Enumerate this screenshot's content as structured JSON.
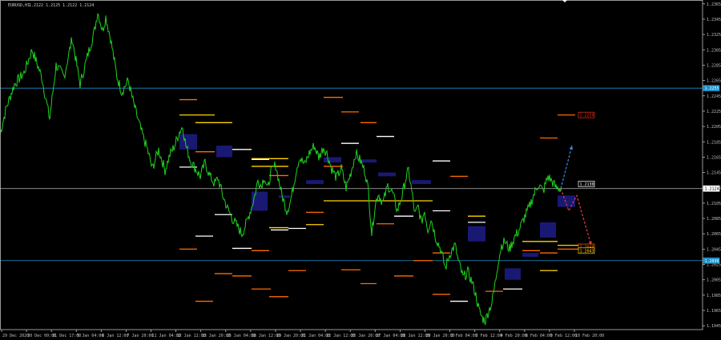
{
  "header": {
    "symbol": "EURUSD,H1",
    "ohlc": "1.2122 1.2125 1.2122 1.2124"
  },
  "colors": {
    "background": "#000000",
    "price_line": "#1fd21f",
    "axis": "#bfbfbf",
    "level_line": "#1e90c8",
    "current_line": "#9a9a9a",
    "zone": "#1a1a7a",
    "seg_white": "#ffffff",
    "seg_yellow": "#ffd400",
    "seg_orange": "#ff6a00",
    "seg_red": "#e03018",
    "arrow_blue": "#3b8fe6",
    "arrow_red": "#e83a3a"
  },
  "chart_data": {
    "type": "line",
    "title": "EURUSD,H1",
    "y_ticks": [
      "1.2365",
      "1.2345",
      "1.2325",
      "1.2305",
      "1.2285",
      "1.2265",
      "1.2245",
      "1.2225",
      "1.2205",
      "1.2185",
      "1.2165",
      "1.2145",
      "1.2125",
      "1.2105",
      "1.2085",
      "1.2065",
      "1.2045",
      "1.2025",
      "1.2005",
      "1.1985",
      "1.1965",
      "1.1945"
    ],
    "x_ticks": [
      "29 Dec 2020",
      "30 Dec 09:00",
      "31 Dec 17:00",
      "5 Jan 04:00",
      "6 Jan 12:00",
      "7 Jan 20:00",
      "11 Jan 04:00",
      "12 Jan 12:00",
      "13 Jan 20:00",
      "15 Jan 04:00",
      "18 Jan 12:00",
      "19 Jan 20:00",
      "21 Jan 04:00",
      "22 Jan 12:00",
      "25 Jan 20:00",
      "27 Jan 04:00",
      "28 Jan 12:00",
      "29 Jan 20:00",
      "2 Feb 04:00",
      "3 Feb 12:00",
      "4 Feb 20:00",
      "8 Feb 04:00",
      "9 Feb 12:00",
      "10 Feb 20:00"
    ],
    "ylim": [
      1.194,
      1.237
    ],
    "price_path": [
      [
        0,
        1.2195
      ],
      [
        8,
        1.223
      ],
      [
        18,
        1.226
      ],
      [
        30,
        1.2275
      ],
      [
        40,
        1.2305
      ],
      [
        52,
        1.227
      ],
      [
        62,
        1.2215
      ],
      [
        70,
        1.2285
      ],
      [
        80,
        1.227
      ],
      [
        90,
        1.232
      ],
      [
        100,
        1.226
      ],
      [
        110,
        1.23
      ],
      [
        118,
        1.233
      ],
      [
        122,
        1.2355
      ],
      [
        128,
        1.233
      ],
      [
        132,
        1.2348
      ],
      [
        138,
        1.232
      ],
      [
        146,
        1.227
      ],
      [
        152,
        1.225
      ],
      [
        160,
        1.2265
      ],
      [
        168,
        1.223
      ],
      [
        176,
        1.22
      ],
      [
        184,
        1.2175
      ],
      [
        190,
        1.215
      ],
      [
        198,
        1.2175
      ],
      [
        206,
        1.2148
      ],
      [
        212,
        1.2168
      ],
      [
        218,
        1.218
      ],
      [
        224,
        1.2198
      ],
      [
        228,
        1.2205
      ],
      [
        232,
        1.218
      ],
      [
        238,
        1.216
      ],
      [
        244,
        1.215
      ],
      [
        250,
        1.214
      ],
      [
        256,
        1.2158
      ],
      [
        262,
        1.214
      ],
      [
        268,
        1.213
      ],
      [
        272,
        1.2138
      ],
      [
        278,
        1.2115
      ],
      [
        284,
        1.2098
      ],
      [
        290,
        1.2085
      ],
      [
        296,
        1.2075
      ],
      [
        302,
        1.2065
      ],
      [
        308,
        1.208
      ],
      [
        314,
        1.21
      ],
      [
        318,
        1.2115
      ],
      [
        322,
        1.2135
      ],
      [
        326,
        1.2128
      ],
      [
        330,
        1.214
      ],
      [
        334,
        1.2122
      ],
      [
        338,
        1.2145
      ],
      [
        344,
        1.2155
      ],
      [
        348,
        1.2135
      ],
      [
        352,
        1.2115
      ],
      [
        358,
        1.2095
      ],
      [
        362,
        1.2105
      ],
      [
        366,
        1.2125
      ],
      [
        370,
        1.215
      ],
      [
        374,
        1.2165
      ],
      [
        380,
        1.2155
      ],
      [
        386,
        1.217
      ],
      [
        392,
        1.218
      ],
      [
        398,
        1.2165
      ],
      [
        404,
        1.2178
      ],
      [
        408,
        1.217
      ],
      [
        414,
        1.215
      ],
      [
        420,
        1.2138
      ],
      [
        426,
        1.215
      ],
      [
        432,
        1.2125
      ],
      [
        438,
        1.2145
      ],
      [
        444,
        1.217
      ],
      [
        450,
        1.216
      ],
      [
        456,
        1.2145
      ],
      [
        460,
        1.212
      ],
      [
        464,
        1.2065
      ],
      [
        468,
        1.21
      ],
      [
        472,
        1.2118
      ],
      [
        478,
        1.2105
      ],
      [
        484,
        1.2128
      ],
      [
        490,
        1.2118
      ],
      [
        496,
        1.2095
      ],
      [
        502,
        1.2115
      ],
      [
        506,
        1.2135
      ],
      [
        510,
        1.2148
      ],
      [
        514,
        1.212
      ],
      [
        518,
        1.209
      ],
      [
        522,
        1.21
      ],
      [
        526,
        1.208
      ],
      [
        530,
        1.2095
      ],
      [
        534,
        1.207
      ],
      [
        538,
        1.2085
      ],
      [
        544,
        1.206
      ],
      [
        550,
        1.2045
      ],
      [
        556,
        1.202
      ],
      [
        562,
        1.204
      ],
      [
        568,
        1.205
      ],
      [
        572,
        1.203
      ],
      [
        578,
        1.2008
      ],
      [
        584,
        1.2015
      ],
      [
        590,
        1.2
      ],
      [
        594,
        1.1985
      ],
      [
        598,
        1.1965
      ],
      [
        602,
        1.1955
      ],
      [
        606,
        1.1952
      ],
      [
        610,
        1.1965
      ],
      [
        614,
        1.1975
      ],
      [
        618,
        1.2
      ],
      [
        622,
        1.203
      ],
      [
        626,
        1.205
      ],
      [
        630,
        1.2055
      ],
      [
        636,
        1.2045
      ],
      [
        642,
        1.206
      ],
      [
        648,
        1.207
      ],
      [
        654,
        1.2085
      ],
      [
        660,
        1.2098
      ],
      [
        666,
        1.2115
      ],
      [
        672,
        1.213
      ],
      [
        678,
        1.212
      ],
      [
        684,
        1.214
      ],
      [
        690,
        1.2132
      ],
      [
        694,
        1.2125
      ],
      [
        700,
        1.2124
      ]
    ],
    "horizontal_levels": [
      1.2255,
      1.2124,
      1.203
    ],
    "price_tags": [
      {
        "value": "1.2255",
        "style": "blue"
      },
      {
        "value": "1.2124",
        "style": "white"
      },
      {
        "value": "1.2030",
        "style": "blue"
      },
      {
        "value": "1.2220",
        "style": "red"
      },
      {
        "value": "1.2130",
        "style": "white"
      },
      {
        "value": "1.2048",
        "style": "orange"
      },
      {
        "value": "1.2043",
        "style": "yellow"
      }
    ],
    "zones": [
      [
        224,
        1.2195,
        246,
        1.2175
      ],
      [
        270,
        1.218,
        290,
        1.2165
      ],
      [
        314,
        1.212,
        334,
        1.2095
      ],
      [
        348,
        1.2115,
        362,
        1.2115
      ],
      [
        382,
        1.2135,
        404,
        1.213
      ],
      [
        404,
        1.2165,
        426,
        1.2158
      ],
      [
        448,
        1.2162,
        470,
        1.2158
      ],
      [
        472,
        1.2145,
        494,
        1.214
      ],
      [
        514,
        1.2135,
        538,
        1.213
      ],
      [
        584,
        1.2075,
        606,
        1.2055
      ],
      [
        630,
        1.202,
        650,
        1.2005
      ],
      [
        652,
        1.204,
        672,
        1.2035
      ],
      [
        674,
        1.208,
        694,
        1.206
      ],
      [
        696,
        1.2115,
        718,
        1.21
      ]
    ],
    "segments": [
      {
        "c": "orange",
        "x1": 224,
        "x2": 246,
        "y": 1.224
      },
      {
        "c": "yellow",
        "x1": 224,
        "x2": 268,
        "y": 1.222
      },
      {
        "c": "yellow",
        "x1": 244,
        "x2": 290,
        "y": 1.221
      },
      {
        "c": "white",
        "x1": 224,
        "x2": 246,
        "y": 1.2152
      },
      {
        "c": "orange",
        "x1": 224,
        "x2": 246,
        "y": 1.2045
      },
      {
        "c": "orange",
        "x1": 244,
        "x2": 266,
        "y": 1.1977
      },
      {
        "c": "white",
        "x1": 244,
        "x2": 266,
        "y": 1.2062
      },
      {
        "c": "orange",
        "x1": 244,
        "x2": 268,
        "y": 1.2172
      },
      {
        "c": "white",
        "x1": 268,
        "x2": 290,
        "y": 1.209
      },
      {
        "c": "white",
        "x1": 290,
        "x2": 314,
        "y": 1.2175
      },
      {
        "c": "white",
        "x1": 290,
        "x2": 314,
        "y": 1.2046
      },
      {
        "c": "orange",
        "x1": 268,
        "x2": 290,
        "y": 1.2013
      },
      {
        "c": "yellow",
        "x1": 314,
        "x2": 360,
        "y": 1.2163
      },
      {
        "c": "white",
        "x1": 314,
        "x2": 336,
        "y": 1.2162
      },
      {
        "c": "yellow",
        "x1": 314,
        "x2": 360,
        "y": 1.2153
      },
      {
        "c": "orange",
        "x1": 314,
        "x2": 336,
        "y": 1.2043
      },
      {
        "c": "orange",
        "x1": 290,
        "x2": 314,
        "y": 1.201
      },
      {
        "c": "orange",
        "x1": 314,
        "x2": 338,
        "y": 1.1993
      },
      {
        "c": "orange",
        "x1": 336,
        "x2": 360,
        "y": 1.2141
      },
      {
        "c": "orange",
        "x1": 336,
        "x2": 360,
        "y": 1.1983
      },
      {
        "c": "yellow",
        "x1": 336,
        "x2": 360,
        "y": 1.2073
      },
      {
        "c": "white",
        "x1": 338,
        "x2": 360,
        "y": 1.207
      },
      {
        "c": "white",
        "x1": 360,
        "x2": 382,
        "y": 1.2072
      },
      {
        "c": "yellow",
        "x1": 382,
        "x2": 404,
        "y": 1.2077
      },
      {
        "c": "orange",
        "x1": 360,
        "x2": 382,
        "y": 1.2017
      },
      {
        "c": "orange",
        "x1": 382,
        "x2": 404,
        "y": 1.2093
      },
      {
        "c": "orange",
        "x1": 404,
        "x2": 428,
        "y": 1.2243
      },
      {
        "c": "orange",
        "x1": 426,
        "x2": 448,
        "y": 1.2224
      },
      {
        "c": "yellow",
        "x1": 404,
        "x2": 540,
        "y": 1.2108
      },
      {
        "c": "white",
        "x1": 426,
        "x2": 448,
        "y": 1.2183
      },
      {
        "c": "orange",
        "x1": 404,
        "x2": 428,
        "y": 1.2153
      },
      {
        "c": "orange",
        "x1": 450,
        "x2": 470,
        "y": 1.221
      },
      {
        "c": "orange",
        "x1": 426,
        "x2": 450,
        "y": 1.2018
      },
      {
        "c": "white",
        "x1": 470,
        "x2": 492,
        "y": 1.2192
      },
      {
        "c": "orange",
        "x1": 470,
        "x2": 492,
        "y": 1.2078
      },
      {
        "c": "orange",
        "x1": 450,
        "x2": 470,
        "y": 1.2
      },
      {
        "c": "white",
        "x1": 492,
        "x2": 516,
        "y": 1.2088
      },
      {
        "c": "orange",
        "x1": 516,
        "x2": 540,
        "y": 1.203
      },
      {
        "c": "orange",
        "x1": 492,
        "x2": 516,
        "y": 1.201
      },
      {
        "c": "white",
        "x1": 540,
        "x2": 562,
        "y": 1.216
      },
      {
        "c": "orange",
        "x1": 562,
        "x2": 584,
        "y": 1.214
      },
      {
        "c": "white",
        "x1": 540,
        "x2": 562,
        "y": 1.2095
      },
      {
        "c": "orange",
        "x1": 540,
        "x2": 562,
        "y": 1.204
      },
      {
        "c": "orange",
        "x1": 540,
        "x2": 562,
        "y": 1.1986
      },
      {
        "c": "white",
        "x1": 562,
        "x2": 584,
        "y": 1.1977
      },
      {
        "c": "yellow",
        "x1": 584,
        "x2": 606,
        "y": 1.2088
      },
      {
        "c": "white",
        "x1": 584,
        "x2": 606,
        "y": 1.208
      },
      {
        "c": "orange",
        "x1": 606,
        "x2": 628,
        "y": 1.199
      },
      {
        "c": "white",
        "x1": 628,
        "x2": 652,
        "y": 1.1993
      },
      {
        "c": "orange",
        "x1": 652,
        "x2": 674,
        "y": 1.2043
      },
      {
        "c": "yellow",
        "x1": 652,
        "x2": 696,
        "y": 1.2055
      },
      {
        "c": "yellow",
        "x1": 674,
        "x2": 696,
        "y": 1.2017
      },
      {
        "c": "orange",
        "x1": 674,
        "x2": 696,
        "y": 1.219
      },
      {
        "c": "orange",
        "x1": 696,
        "x2": 718,
        "y": 1.222
      },
      {
        "c": "yellow",
        "x1": 696,
        "x2": 740,
        "y": 1.205
      },
      {
        "c": "orange",
        "x1": 696,
        "x2": 740,
        "y": 1.2045
      },
      {
        "c": "orange",
        "x1": 674,
        "x2": 696,
        "y": 1.204
      }
    ],
    "arrows": [
      {
        "color": "blue",
        "from": [
          700,
          1.2124
        ],
        "to": [
          714,
          1.218
        ]
      },
      {
        "color": "red",
        "from": [
          700,
          1.2124
        ],
        "to": [
          710,
          1.2095
        ],
        "via": [
          720,
          1.2115
        ],
        "end": [
          738,
          1.205
        ]
      }
    ]
  }
}
